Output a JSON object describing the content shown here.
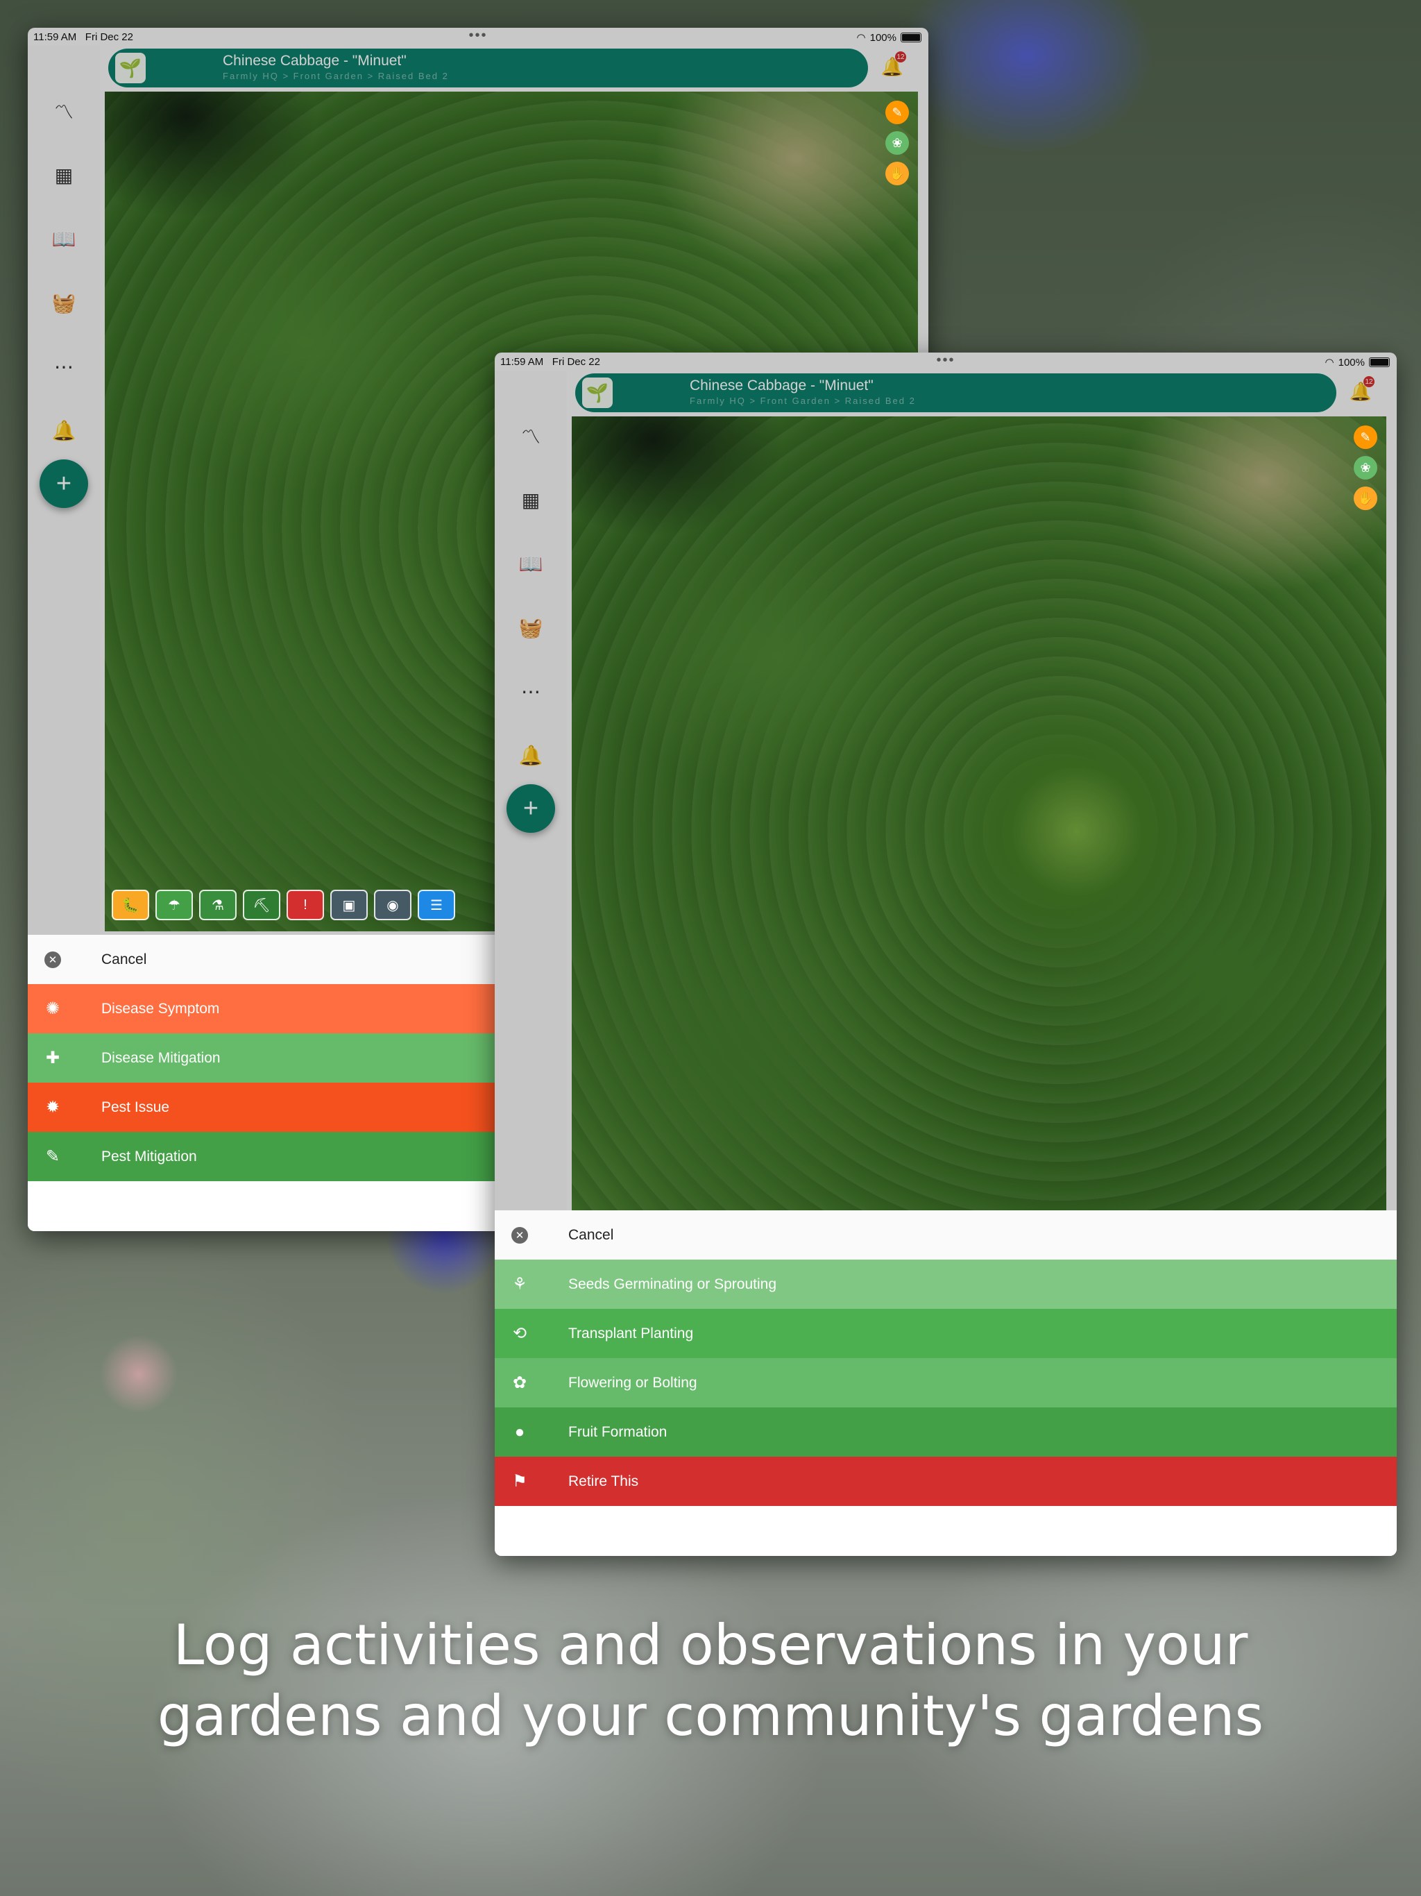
{
  "caption": {
    "line1": "Log activities and observations in your",
    "line2": "gardens and your community's gardens"
  },
  "status_bar": {
    "time": "11:59 AM",
    "date": "Fri Dec 22",
    "battery": "100%"
  },
  "plant": {
    "title": "Chinese Cabbage - \"Minuet\"",
    "breadcrumb": "Farmly HQ > Front Garden > Raised Bed 2",
    "notification_count": "12"
  },
  "sidebar_icons": [
    "chart-line-icon",
    "dashboard-icon",
    "book-open-icon",
    "basket-icon",
    "more-icon",
    "bell-icon",
    "plus-icon"
  ],
  "photo_actions": [
    "pencil-icon",
    "sprout-icon",
    "harvest-icon"
  ],
  "toolbar_icons": [
    "bug-icon",
    "watering-icon",
    "fertilize-icon",
    "planting-icon",
    "alert-icon",
    "image-icon",
    "camera-icon",
    "note-icon"
  ],
  "sheet1": {
    "cancel": "Cancel",
    "items": [
      {
        "label": "Disease Symptom",
        "color": "#FF6E40",
        "icon": "virus-icon"
      },
      {
        "label": "Disease Mitigation",
        "color": "#66BB6A",
        "icon": "medicine-icon"
      },
      {
        "label": "Pest Issue",
        "color": "#F4511E",
        "icon": "bug-icon"
      },
      {
        "label": "Pest Mitigation",
        "color": "#43A047",
        "icon": "spray-icon"
      }
    ]
  },
  "sheet2": {
    "cancel": "Cancel",
    "items": [
      {
        "label": "Seeds Germinating or Sprouting",
        "color": "#81C784",
        "icon": "seedling-icon"
      },
      {
        "label": "Transplant Planting",
        "color": "#4CAF50",
        "icon": "transplant-icon"
      },
      {
        "label": "Flowering or Bolting",
        "color": "#66BB6A",
        "icon": "flower-icon"
      },
      {
        "label": "Fruit Formation",
        "color": "#43A047",
        "icon": "fruit-icon"
      },
      {
        "label": "Retire This",
        "color": "#D32F2F",
        "icon": "retire-icon"
      }
    ]
  },
  "colors": {
    "brand": "#0D7D6A",
    "badge": "#D32F2F"
  }
}
